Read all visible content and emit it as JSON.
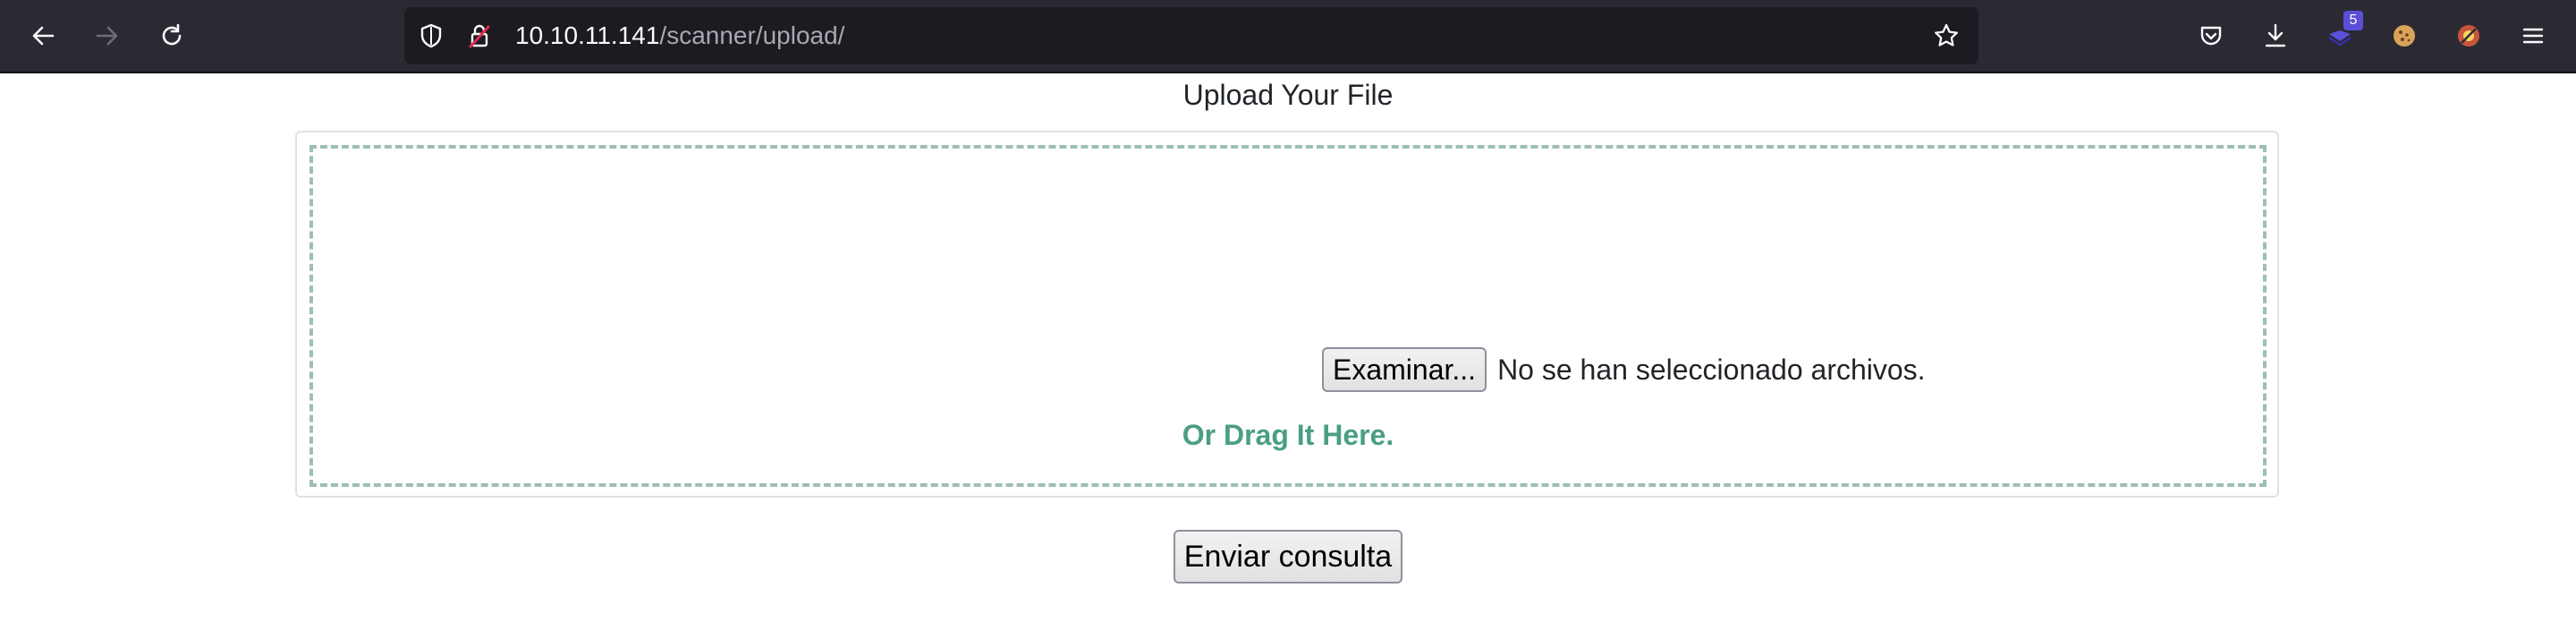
{
  "browser": {
    "url_host": "10.10.11.141",
    "url_path": "/scanner/upload/",
    "extension_badge": "5",
    "icons": {
      "back": "arrow-left-icon",
      "forward": "arrow-right-icon",
      "reload": "reload-icon",
      "tracking_protection": "shield-icon",
      "connection": "insecure-lock-icon",
      "bookmark": "star-icon",
      "pocket": "pocket-icon",
      "downloads": "download-icon",
      "extension_1": "extension-icon",
      "extension_cookie": "cookie-icon",
      "extension_3": "extension-icon",
      "menu": "hamburger-menu-icon"
    }
  },
  "page": {
    "title": "Upload Your File",
    "browse_label": "Examinar...",
    "file_status": "No se han seleccionado archivos.",
    "drag_hint": "Or Drag It Here.",
    "submit_label": "Enviar consulta"
  },
  "colors": {
    "accent_green": "#4b9e86",
    "dashed_border": "#9dbfb3",
    "toolbar_bg": "#2b2a33",
    "urlbar_bg": "#1c1b22"
  }
}
